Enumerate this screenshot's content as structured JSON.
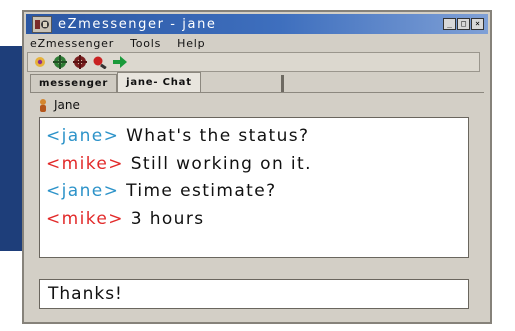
{
  "window": {
    "title": "eZmessenger - jane"
  },
  "window_controls": {
    "minimize": "_",
    "maximize": "□",
    "close": "×"
  },
  "menu": [
    "eZmessenger",
    "Tools",
    "Help"
  ],
  "toolbar": {
    "buttons": [
      {
        "name": "status-icon"
      },
      {
        "name": "users-icon"
      },
      {
        "name": "group-icon"
      },
      {
        "name": "search-icon"
      },
      {
        "name": "forward-arrow-icon"
      }
    ]
  },
  "tabs": [
    {
      "label": "messenger",
      "active": false
    },
    {
      "label": "jane- Chat",
      "active": true
    }
  ],
  "chat": {
    "room": "Jane",
    "messages": [
      {
        "nick": "<jane>",
        "text": "What's the status?",
        "color": "#2d93c9"
      },
      {
        "nick": "<mike>",
        "text": "Still working on it.",
        "color": "#e22a2a"
      },
      {
        "nick": "<jane>",
        "text": "Time estimate?",
        "color": "#2d93c9"
      },
      {
        "nick": "<mike>",
        "text": "3 hours",
        "color": "#e22a2a"
      }
    ],
    "input_value": "Thanks!"
  },
  "colors": {
    "titlebar": "#2b57a3",
    "window_bg": "#d3cfc6",
    "jane": "#2d93c9",
    "mike": "#e22a2a"
  }
}
